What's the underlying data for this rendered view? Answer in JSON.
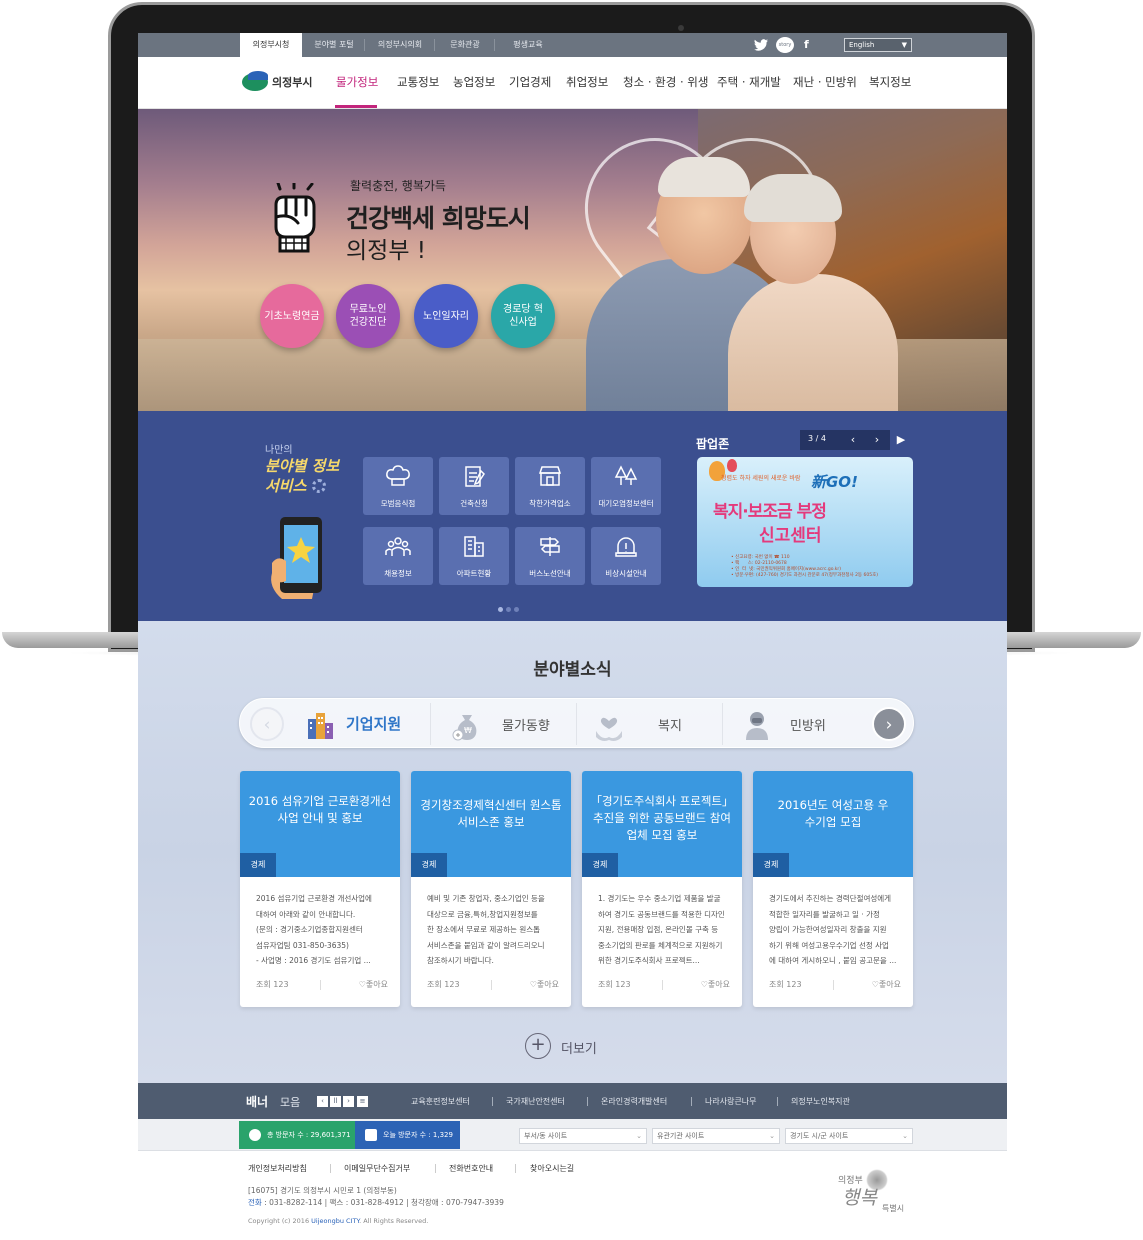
{
  "topbar": {
    "tabs": [
      "의정부시청",
      "분야별 포털",
      "의정부시의회",
      "문화관광",
      "평생교육"
    ],
    "sns": {
      "twitter": "twitter-icon",
      "kakaostory": "story",
      "facebook": "f"
    },
    "language": "English"
  },
  "header": {
    "logo_text": "의정부시",
    "nav": [
      "물가정보",
      "교통정보",
      "농업정보",
      "기업경제",
      "취업정보",
      "청소 · 환경 · 위생",
      "주택 · 재개발",
      "재난 · 민방위",
      "복지정보"
    ]
  },
  "hero": {
    "subtitle": "활력충전, 행복가득",
    "title": "건강백세 희망도시",
    "title2": "의정부 !",
    "circles": [
      {
        "label": "기초노령연금",
        "color": "#e66a9c"
      },
      {
        "label": "무료노인 건강진단",
        "color": "#9b4fb5"
      },
      {
        "label": "노인일자리",
        "color": "#4a5dc8"
      },
      {
        "label": "경로당 혁신사업",
        "color": "#2aa7a8"
      }
    ]
  },
  "services": {
    "my": "나만의",
    "line1": "분야별 정보",
    "line2": "서비스",
    "tiles": [
      "모범음식점",
      "건축신청",
      "착한가격업소",
      "대기오염정보센터",
      "채용정보",
      "아파트현황",
      "버스노선안내",
      "비상시설안내"
    ]
  },
  "popup": {
    "title": "팝업존",
    "page": "3 / 4",
    "caption": "청렴도 하자 세원의 새로운 바람",
    "new_text": "新GO!",
    "line1": "복지·보조금 부정",
    "line2": "신고센터",
    "fine_print": "• 신고요령: 국번 없이 ☎ 110\n• 팩      스: 02-2110-0678\n• 인  터  넷: 국민권익위원회 홈페이지(www.acrc.go.kr)\n• 방문·우편: (427-760) 경기도 과천시 관문로 47(정부과천청사 2동 605호)"
  },
  "news": {
    "title": "분야별소식",
    "categories": [
      "기업지원",
      "물가동향",
      "복지",
      "민방위"
    ],
    "cards": [
      {
        "title": "2016 섬유기업 근로환경개선 사업 안내 및 홍보",
        "tag": "경제",
        "lines": [
          "2016 섬유기업 근로환경 개선사업에",
          "대하여 아래와 같이 안내합니다.",
          "(문의 : 경기중소기업종합지원센터",
          "섬유자업팀 031-850-3635)",
          "- 사업명 : 2016 경기도 섬유기업 ..."
        ],
        "views": "조회  123",
        "like": "♡좋아요"
      },
      {
        "title": "경기창조경제혁신센터 원스톱서비스존 홍보",
        "tag": "경제",
        "lines": [
          "예비 및 기존 창업자, 중소기업인 등을",
          "대상으로 금융,특허,창업지원정보를",
          "한 장소에서 무료로 제공하는 원스톱",
          "서비스존을 붙임과 같이 알려드리오니",
          "참조하시기 바랍니다."
        ],
        "views": "조회  123",
        "like": "♡좋아요"
      },
      {
        "title": "「경기도주식회사 프로젝트」 추진을 위한 공동브랜드 참여업체 모집 홍보",
        "tag": "경제",
        "lines": [
          "1. 경기도는 우수 중소기업 제품을 발굴",
          "하여 경기도 공동브랜드를 적용한 디자인",
          "지원, 전용매장 입점, 온라인몰 구축 등",
          "중소기업의 판로를 체계적으로 지원하기",
          "위한 경기도주식회사 프로젝트..."
        ],
        "views": "조회  123",
        "like": "♡좋아요"
      },
      {
        "title": "2016년도 여성고용 우수기업 모집",
        "tag": "경제",
        "lines": [
          "경기도에서 추진하는 경력단절여성에게",
          "적합한 일자리를 발굴하고 일 · 가정",
          "양립이 가능한여성일자리 창출을 지원",
          "하기 위해 여성고용우수기업 선정 사업",
          "에 대하여 게시하오니 , 붙임 공고문을 ..."
        ],
        "views": "조회  123",
        "like": "♡좋아요"
      }
    ],
    "more": "더보기"
  },
  "banner": {
    "title_bold": "배너",
    "title_rest": "모음",
    "links": [
      "교육훈련정보센터",
      "국가재난안전센터",
      "온라인경력개발센터",
      "나라사랑큰나무",
      "의정부노인복지관"
    ]
  },
  "stats": {
    "total": "총 방문자 수 : 29,601,371",
    "today": "오늘 방문자 수 : 1,329",
    "selects": [
      "부서/동 사이트",
      "유관기관 사이트",
      "경기도 시/군 사이트"
    ]
  },
  "footer": {
    "links": [
      "개인정보처리방침",
      "이메일무단수집거부",
      "전화번호안내",
      "찾아오시는길"
    ],
    "address": "[16075] 경기도 의정부시 시민로 1 (의정부동)",
    "phone_label": "전화",
    "phone_rest": " : 031-8282-114   |   팩스 : 031-828-4912   |   청각장애 : 070-7947-3939",
    "copyright_pre": "Copyright (c) 2016 ",
    "copyright_brand": "Uijeongbu CITY",
    "copyright_post": ". All Rights Reserved.",
    "logo_line1": "의정부",
    "logo_line2": "행복",
    "logo_line3": "특별시"
  }
}
